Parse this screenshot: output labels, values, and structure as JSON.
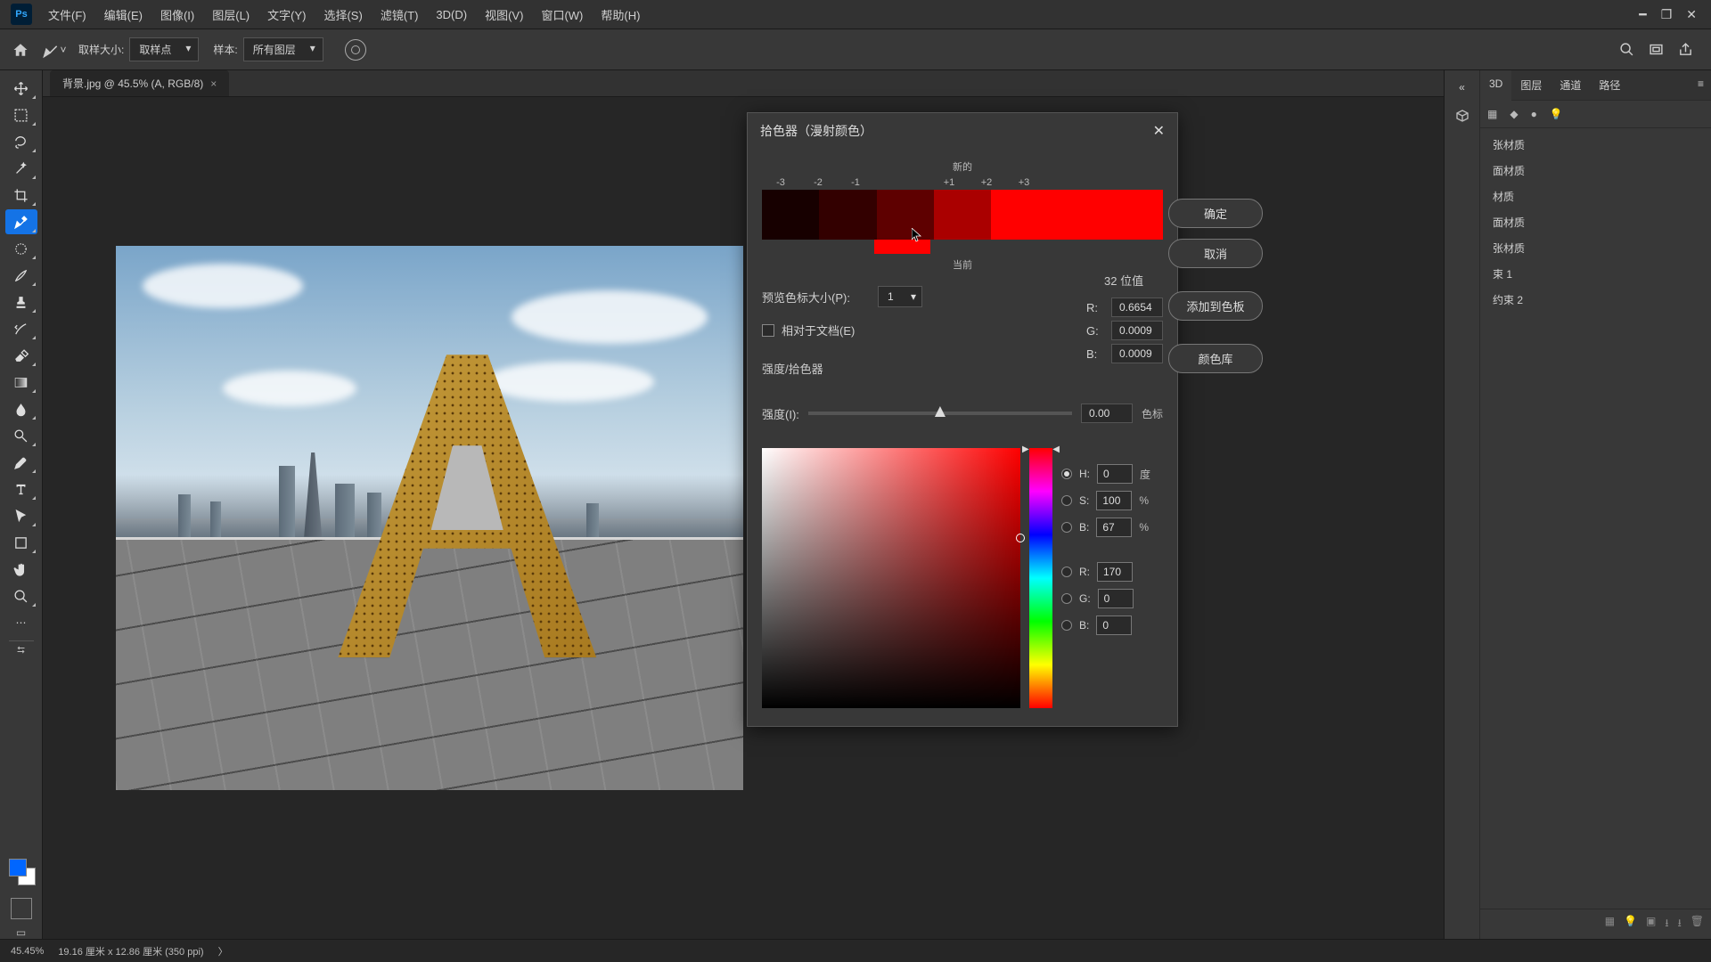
{
  "menubar": {
    "items": [
      "文件(F)",
      "编辑(E)",
      "图像(I)",
      "图层(L)",
      "文字(Y)",
      "选择(S)",
      "滤镜(T)",
      "3D(D)",
      "视图(V)",
      "窗口(W)",
      "帮助(H)"
    ]
  },
  "optbar": {
    "sample_size_label": "取样大小:",
    "sample_size_value": "取样点",
    "sample_label": "样本:",
    "sample_value": "所有图层"
  },
  "tab": {
    "title": "背景.jpg @ 45.5% (A, RGB/8)"
  },
  "panels": {
    "tabs": [
      "3D",
      "图层",
      "通道",
      "路径"
    ],
    "materials": [
      "张材质",
      "面材质",
      "材质",
      "面材质",
      "张材质",
      "束 1",
      "约束 2"
    ]
  },
  "dialog": {
    "title": "拾色器（漫射颜色）",
    "stops": [
      "-3",
      "-2",
      "-1",
      "",
      "+1",
      "+2",
      "+3"
    ],
    "stops_new": "新的",
    "stops_current": "当前",
    "preview_label": "预览色标大小(P):",
    "preview_value": "1",
    "relative_label": "相对于文档(E)",
    "section_label": "强度/拾色器",
    "rgb32_label": "32 位值",
    "r32": "0.6654",
    "g32": "0.0009",
    "b32": "0.0009",
    "intensity_label": "强度(I):",
    "intensity_value": "0.00",
    "intensity_unit": "色标",
    "btn_ok": "确定",
    "btn_cancel": "取消",
    "btn_add": "添加到色板",
    "btn_lib": "颜色库",
    "hsb": {
      "h": "0",
      "h_unit": "度",
      "s": "100",
      "s_unit": "%",
      "b": "67",
      "b_unit": "%",
      "rr": "170",
      "gg": "0",
      "bb": "0"
    }
  },
  "status": {
    "zoom": "45.45%",
    "dims": "19.16 厘米 x 12.86 厘米 (350 ppi)"
  },
  "swatch_colors": {
    "m3": "#170000",
    "m2": "#330000",
    "m1": "#5e0000",
    "c0": "#aa0000",
    "p1": "#ff0000",
    "p2": "#ff0000",
    "p3": "#ff0000",
    "current": "#ff0000"
  }
}
